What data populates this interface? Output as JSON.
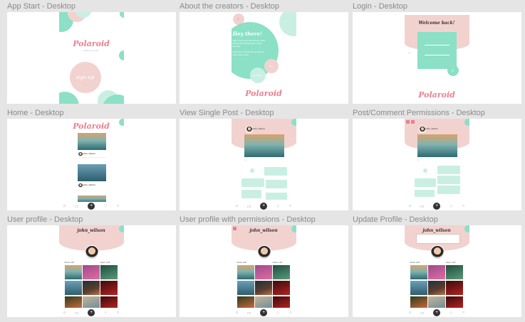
{
  "frames": [
    {
      "label": "App Start - Desktop",
      "logo": "Polaroid",
      "tagline": "Share your story",
      "button": "sign up"
    },
    {
      "label": "About the creators - Desktop",
      "heading": "Hey there!",
      "body": "We're Tam Loan and Anthony Nutt and we're Polaroid team. Enjoy the rest!",
      "body2": "Feel free to check out our links to view other works.",
      "badge1": "Tam",
      "badge2": "Anthony",
      "logo": "Polaroid"
    },
    {
      "label": "Login - Desktop",
      "heading": "Welcome back!",
      "logo": "Polaroid"
    },
    {
      "label": "Home - Desktop",
      "logo": "Polaroid",
      "user": "john_wilson"
    },
    {
      "label": "View Single Post - Desktop",
      "user": "john_wilson"
    },
    {
      "label": "Post/Comment Permissions - Desktop",
      "user": "john_wilson"
    },
    {
      "label": "User profile - Desktop",
      "user": "john_wilson",
      "posts": "Posts 128",
      "likes": "Likes 1.2K"
    },
    {
      "label": "User profile with permissions - Desktop",
      "user": "john_wilson",
      "posts": "Posts 128",
      "likes": "Likes 1.2K"
    },
    {
      "label": "Update Profile - Desktop",
      "user": "john_wilson",
      "posts": "Posts 128",
      "likes": "Likes 1.2K"
    }
  ],
  "tabbar": {
    "home": "⌂",
    "chat": "▭",
    "add": "+",
    "bell": "♢",
    "user": "○"
  },
  "colors": {
    "pink": "#f2d2cf",
    "mint": "#8be0c6",
    "logo": "#ee7e8e",
    "canvas": "#e5e5e5"
  }
}
